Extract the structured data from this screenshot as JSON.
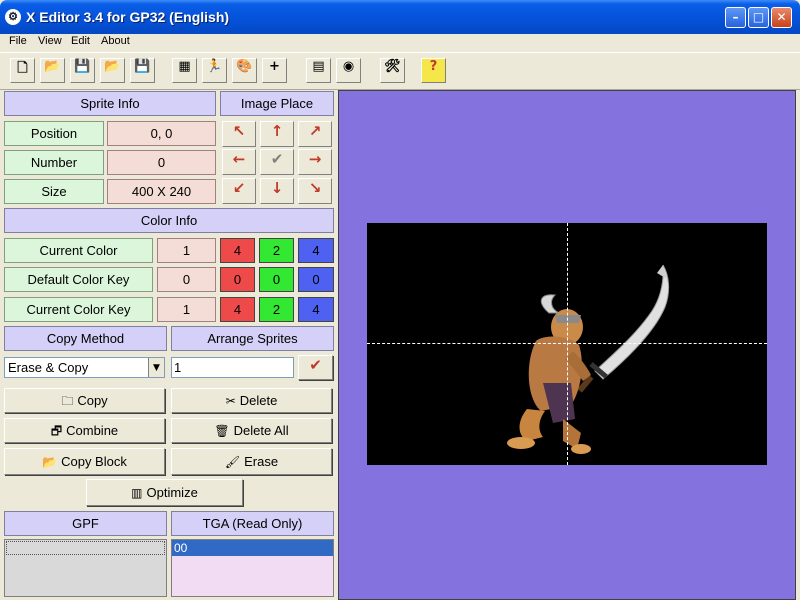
{
  "window": {
    "app_icon": "gear-icon",
    "title": "X Editor 3.4 for GP32 (English)",
    "controls": [
      "minimize-icon",
      "maximize-icon",
      "close-icon"
    ]
  },
  "menu": [
    "File",
    "View",
    "Edit",
    "About"
  ],
  "toolbar": [
    {
      "name": "new-file-icon",
      "glyph": "🗋"
    },
    {
      "name": "open-folder-icon",
      "glyph": "📂"
    },
    {
      "name": "save-icon",
      "glyph": "💾"
    },
    {
      "name": "open-folder-2-icon",
      "glyph": "📂"
    },
    {
      "name": "save-2-icon",
      "glyph": "💾"
    },
    {
      "name": "sprite-sheet-icon",
      "glyph": "▦"
    },
    {
      "name": "running-man-icon",
      "glyph": "🏃"
    },
    {
      "name": "palette-icon",
      "glyph": "🎨"
    },
    {
      "name": "plus-icon",
      "glyph": "+"
    },
    {
      "name": "calendar-grid-icon",
      "glyph": "▤"
    },
    {
      "name": "disc-icon",
      "glyph": "◉"
    },
    {
      "name": "tools-icon",
      "glyph": "🛠"
    },
    {
      "name": "help-icon",
      "glyph": "?"
    }
  ],
  "sprite_info": {
    "header": "Sprite Info",
    "image_place_header": "Image Place",
    "position_label": "Position",
    "position_value": "0, 0",
    "number_label": "Number",
    "number_value": "0",
    "size_label": "Size",
    "size_value": "400 X 240"
  },
  "arrows": [
    "↖",
    "↑",
    "↗",
    "←",
    "✔",
    "→",
    "↙",
    "↓",
    "↘"
  ],
  "color_info": {
    "header": "Color Info",
    "rows": [
      {
        "label": "Current Color",
        "index": "1",
        "r": "4",
        "g": "2",
        "b": "4"
      },
      {
        "label": "Default Color Key",
        "index": "0",
        "r": "0",
        "g": "0",
        "b": "0"
      },
      {
        "label": "Current Color Key",
        "index": "1",
        "r": "4",
        "g": "2",
        "b": "4"
      }
    ],
    "colors": {
      "r": "#ef4a4a",
      "g": "#32e832",
      "b": "#4f61f0"
    }
  },
  "copy_method": {
    "header": "Copy Method",
    "selected": "Erase & Copy"
  },
  "arrange_sprites": {
    "header": "Arrange Sprites",
    "value": "1",
    "apply_glyph": "✔"
  },
  "buttons": {
    "copy": "Copy",
    "delete": "Delete",
    "combine": "Combine",
    "delete_all": "Delete All",
    "copy_block": "Copy Block",
    "erase": "Erase",
    "optimize": "Optimize"
  },
  "lists": {
    "gpf_header": "GPF",
    "tga_header": "TGA (Read Only)",
    "tga_items": [
      "00"
    ]
  }
}
